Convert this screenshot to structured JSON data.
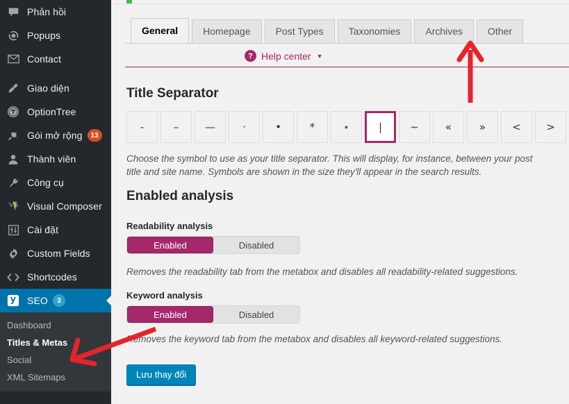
{
  "sidebar": {
    "items": [
      {
        "label": "Phản hồi",
        "icon": "comment-icon",
        "badge": null
      },
      {
        "label": "Popups",
        "icon": "popups-icon",
        "badge": null
      },
      {
        "label": "Contact",
        "icon": "envelope-icon",
        "badge": null
      },
      {
        "label": "Giao diện",
        "icon": "appearance-brush-icon",
        "badge": null
      },
      {
        "label": "OptionTree",
        "icon": "optiontree-icon",
        "badge": null
      },
      {
        "label": "Gói mở rộng",
        "icon": "plugin-icon",
        "badge": "13"
      },
      {
        "label": "Thành viên",
        "icon": "user-icon",
        "badge": null
      },
      {
        "label": "Công cụ",
        "icon": "wrench-icon",
        "badge": null
      },
      {
        "label": "Visual Composer",
        "icon": "visual-composer-icon",
        "badge": null
      },
      {
        "label": "Cài đặt",
        "icon": "settings-sliders-icon",
        "badge": null
      },
      {
        "label": "Custom Fields",
        "icon": "gear-icon",
        "badge": null
      },
      {
        "label": "Shortcodes",
        "icon": "code-brackets-icon",
        "badge": null
      },
      {
        "label": "SEO",
        "icon": "yoast-seo-icon",
        "badge": "3",
        "current": true
      }
    ],
    "submenu": [
      {
        "label": "Dashboard",
        "active": false
      },
      {
        "label": "Titles & Metas",
        "active": true
      },
      {
        "label": "Social",
        "active": false
      },
      {
        "label": "XML Sitemaps",
        "active": false
      }
    ],
    "colors": {
      "background": "#23282d",
      "submenu_background": "#32373c",
      "current_background": "#0073aa",
      "badge_orange": "#d54e21",
      "badge_blue": "#2ea2cc"
    }
  },
  "content": {
    "tabs": [
      {
        "label": "General",
        "active": true
      },
      {
        "label": "Homepage",
        "active": false
      },
      {
        "label": "Post Types",
        "active": false
      },
      {
        "label": "Taxonomies",
        "active": false
      },
      {
        "label": "Archives",
        "active": false
      },
      {
        "label": "Other",
        "active": false
      }
    ],
    "help_center": {
      "label": "Help center",
      "icon": "question-mark-icon",
      "caret": "▼",
      "color": "#a4286a"
    },
    "title_separator": {
      "heading": "Title Separator",
      "options": [
        {
          "glyph": "-",
          "name": "hyphen",
          "selected": false
        },
        {
          "glyph": "–",
          "name": "en-dash",
          "selected": false
        },
        {
          "glyph": "—",
          "name": "em-dash",
          "selected": false
        },
        {
          "glyph": "·",
          "name": "middle-dot",
          "selected": false
        },
        {
          "glyph": "•",
          "name": "bullet",
          "selected": false
        },
        {
          "glyph": "*",
          "name": "asterisk",
          "selected": false
        },
        {
          "glyph": "⋆",
          "name": "star-operator",
          "selected": false
        },
        {
          "glyph": "|",
          "name": "vertical-bar",
          "selected": true
        },
        {
          "glyph": "~",
          "name": "tilde",
          "selected": false
        },
        {
          "glyph": "«",
          "name": "left-double-angle",
          "selected": false
        },
        {
          "glyph": "»",
          "name": "right-double-angle",
          "selected": false
        },
        {
          "glyph": "<",
          "name": "less-than",
          "selected": false
        },
        {
          "glyph": ">",
          "name": "greater-than",
          "selected": false
        }
      ],
      "description": "Choose the symbol to use as your title separator. This will display, for instance, between your post title and site name. Symbols are shown in the size they'll appear in the search results."
    },
    "enabled_analysis": {
      "heading": "Enabled analysis",
      "readability": {
        "label": "Readability analysis",
        "enabled_label": "Enabled",
        "disabled_label": "Disabled",
        "selected": "Enabled",
        "description": "Removes the readability tab from the metabox and disables all readability-related suggestions."
      },
      "keyword": {
        "label": "Keyword analysis",
        "enabled_label": "Enabled",
        "disabled_label": "Disabled",
        "selected": "Enabled",
        "description": "Removes the keyword tab from the metabox and disables all keyword-related suggestions."
      },
      "active_color": "#a4286a"
    },
    "save_button": {
      "label": "Lưu thay đổi",
      "color": "#0085ba"
    },
    "annotations": {
      "arrow_color": "#e8232a",
      "arrow_to_other_tab": "points up at the Other tab",
      "arrow_to_titles_metas": "points down-left at the Titles & Metas submenu item"
    }
  }
}
